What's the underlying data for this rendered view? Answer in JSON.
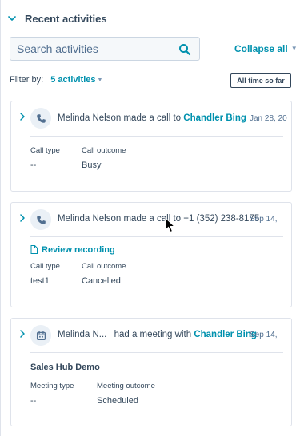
{
  "section": {
    "title": "Recent activities"
  },
  "search": {
    "placeholder": "Search activities"
  },
  "collapse_all": "Collapse all",
  "filter": {
    "label": "Filter by:",
    "activities_link": "5 activities",
    "time_button": "All time so far"
  },
  "activities": [
    {
      "type_icon": "phone-icon",
      "actor": "Melinda Nelson",
      "action": "made a call to",
      "target": "Chandler Bing",
      "date": "Jan 28, 20",
      "fields": [
        {
          "label": "Call type",
          "value": "--"
        },
        {
          "label": "Call outcome",
          "value": "Busy"
        }
      ]
    },
    {
      "type_icon": "phone-icon",
      "actor": "Melinda Nelson",
      "action": "made a call to",
      "target": "+1 (352) 238-8175",
      "date": "Sep 14,",
      "recording_link": "Review recording",
      "fields": [
        {
          "label": "Call type",
          "value": "test1"
        },
        {
          "label": "Call outcome",
          "value": "Cancelled"
        }
      ]
    },
    {
      "type_icon": "calendar-icon",
      "actor": "Melinda N...",
      "action": "had a meeting with",
      "target": "Chandler Bing",
      "date": "Sep 14,",
      "meeting_title": "Sales Hub Demo",
      "fields": [
        {
          "label": "Meeting type",
          "value": "--"
        },
        {
          "label": "Meeting outcome",
          "value": "Scheduled"
        }
      ]
    }
  ],
  "colors": {
    "link": "#0091ae",
    "text": "#33475b",
    "border": "#dfe3eb"
  }
}
